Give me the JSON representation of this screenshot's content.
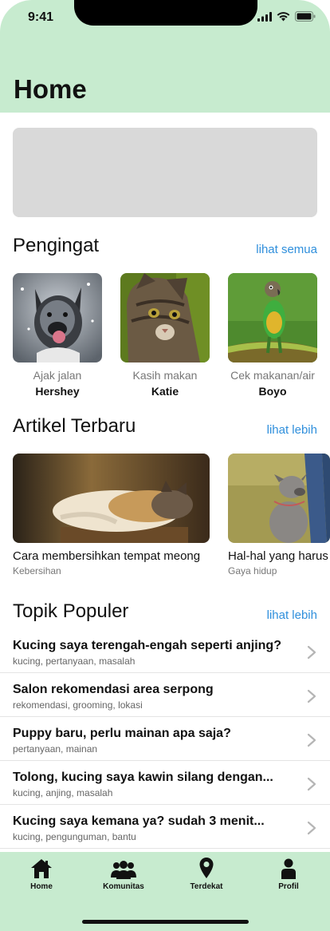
{
  "status": {
    "time": "9:41"
  },
  "header": {
    "title": "Home"
  },
  "reminders": {
    "title": "Pengingat",
    "link": "lihat semua",
    "items": [
      {
        "task": "Ajak jalan",
        "pet": "Hershey",
        "image": "dog-photo"
      },
      {
        "task": "Kasih makan",
        "pet": "Katie",
        "image": "cat-photo"
      },
      {
        "task": "Cek makanan/air",
        "pet": "Boyo",
        "image": "parrot-photo"
      }
    ]
  },
  "articles": {
    "title": "Artikel Terbaru",
    "link": "lihat lebih",
    "items": [
      {
        "title": "Cara membersihkan tempat meong",
        "category": "Kebersihan",
        "image": "sleeping-cat-photo"
      },
      {
        "title": "Hal-hal yang harus",
        "category": "Gaya hidup",
        "image": "dog-on-grass-photo"
      }
    ]
  },
  "topics": {
    "title": "Topik Populer",
    "link": "lihat lebih",
    "items": [
      {
        "title": "Kucing saya terengah-engah seperti anjing?",
        "tags": "kucing, pertanyaan, masalah"
      },
      {
        "title": "Salon rekomendasi area serpong",
        "tags": "rekomendasi, grooming, lokasi"
      },
      {
        "title": "Puppy baru, perlu mainan apa saja?",
        "tags": "pertanyaan, mainan"
      },
      {
        "title": "Tolong, kucing saya kawin silang dengan...",
        "tags": "kucing, anjing, masalah"
      },
      {
        "title": "Kucing saya kemana ya? sudah 3 menit...",
        "tags": "kucing, pengunguman, bantu"
      }
    ]
  },
  "tabbar": {
    "items": [
      {
        "label": "Home",
        "icon": "home-icon"
      },
      {
        "label": "Komunitas",
        "icon": "community-icon"
      },
      {
        "label": "Terdekat",
        "icon": "location-pin-icon"
      },
      {
        "label": "Profil",
        "icon": "profile-icon"
      }
    ]
  },
  "colors": {
    "header_bg": "#c7ebcf",
    "link": "#2f8fdc",
    "banner": "#d9d9d9"
  }
}
